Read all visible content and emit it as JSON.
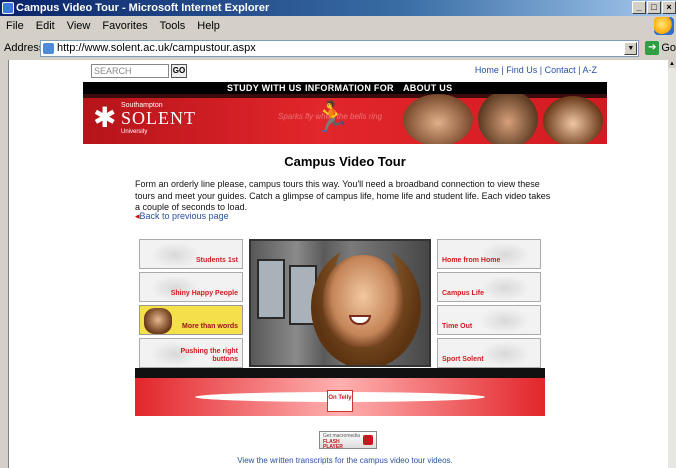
{
  "window": {
    "title": "Campus Video Tour - Microsoft Internet Explorer",
    "min": "_",
    "max": "□",
    "close": "×"
  },
  "menu": [
    "File",
    "Edit",
    "View",
    "Favorites",
    "Tools",
    "Help"
  ],
  "address": {
    "label": "Address",
    "url": "http://www.solent.ac.uk/campustour.aspx",
    "go": "Go"
  },
  "site": {
    "search_placeholder": "SEARCH",
    "search_go": "GO",
    "util_links": [
      "Home",
      "Find Us",
      "Contact",
      "A-Z"
    ],
    "nav": [
      "STUDY WITH US",
      "INFORMATION FOR",
      "ABOUT US"
    ],
    "logo": {
      "line1": "Southampton",
      "line2": "SOLENT",
      "line3": "University"
    },
    "banner_faint": "Sparks fly when the bells ring"
  },
  "content": {
    "heading": "Campus Video Tour",
    "intro": "Form an orderly line please, campus tours this way. You'll need a broadband connection to view these tours and meet your guides. Catch a glimpse of campus life, home life and student life. Each video takes a couple of seconds to load.",
    "back": "Back to previous page"
  },
  "tiles_left": [
    "Students 1st",
    "Shiny Happy People",
    "More than words",
    "Pushing the right buttons"
  ],
  "tiles_right": [
    "Home from Home",
    "Campus Life",
    "Time Out",
    "Sport Solent"
  ],
  "on_telly": "On Telly",
  "flash": {
    "line1": "Get macromedia",
    "line2": "FLASH",
    "line3": "PLAYER"
  },
  "transcripts": "View the written transcripts for the campus video tour videos."
}
